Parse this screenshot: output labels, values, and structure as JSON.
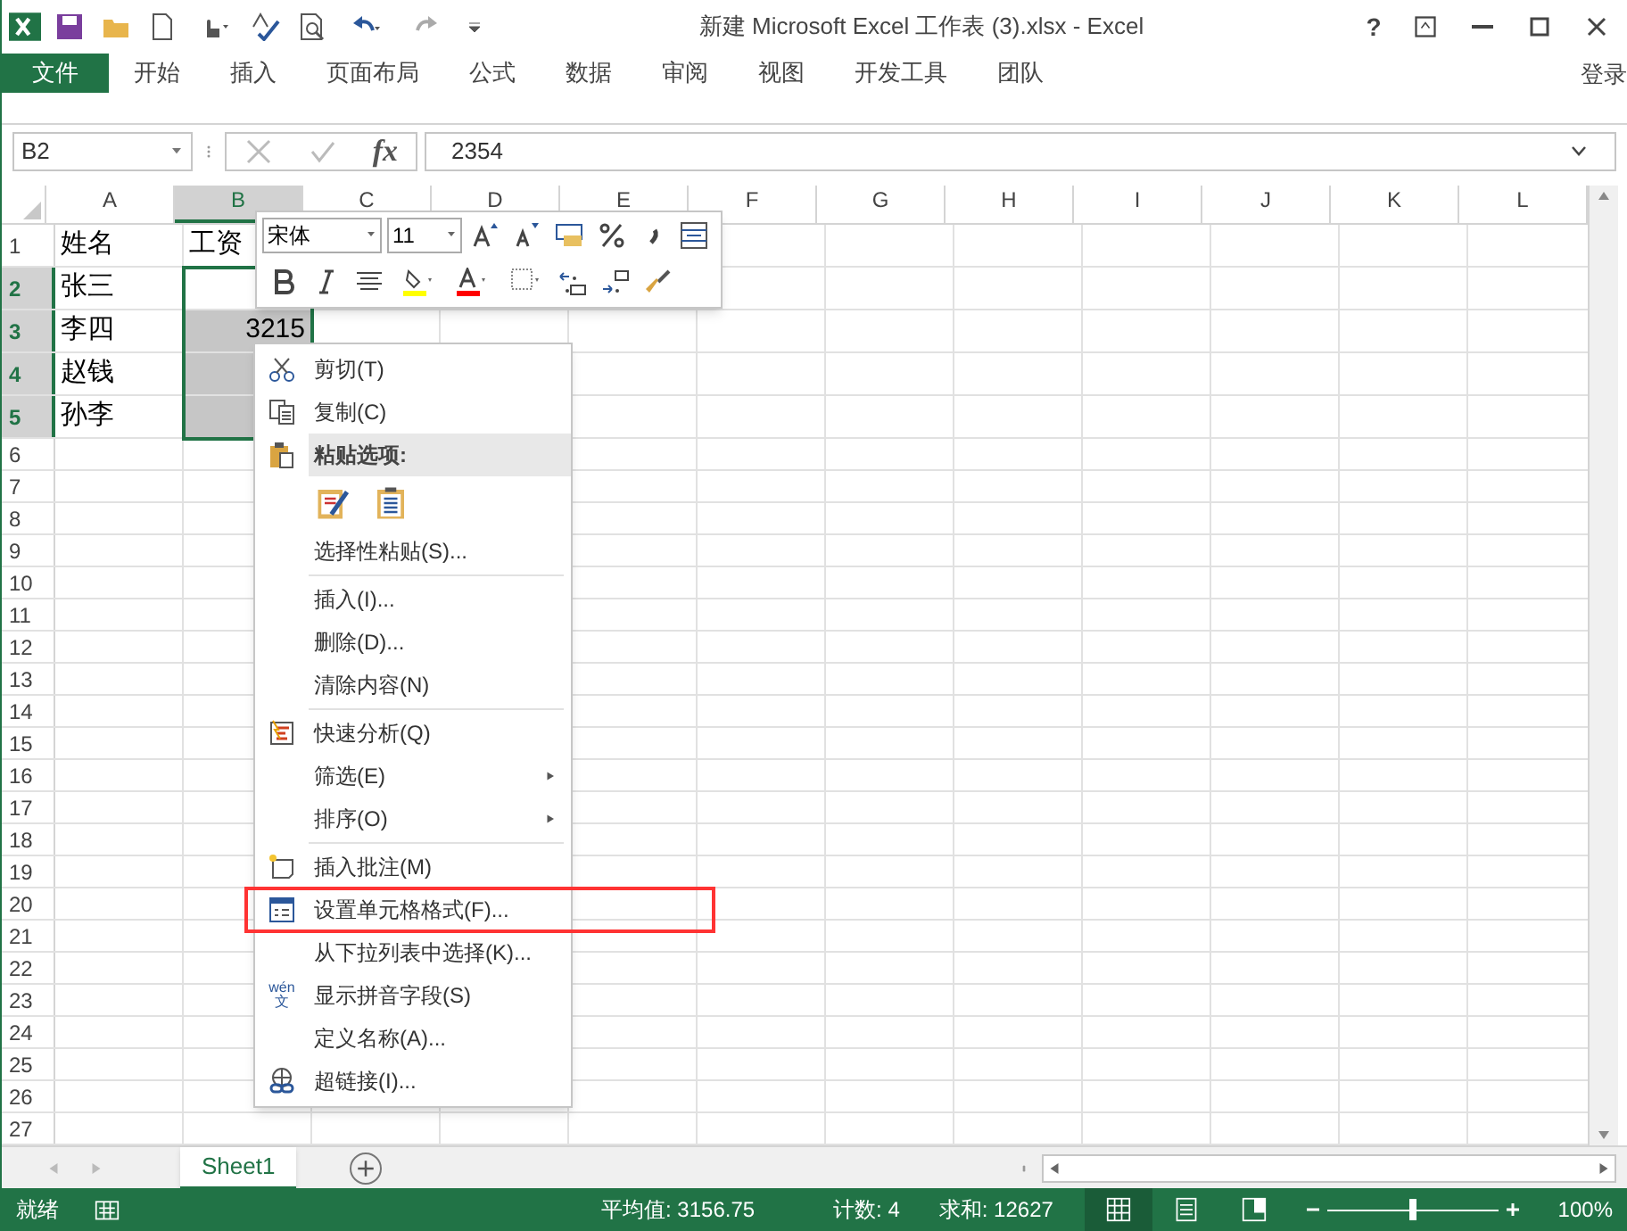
{
  "window": {
    "title": "新建 Microsoft Excel 工作表 (3).xlsx - Excel",
    "help": "?"
  },
  "ribbon_tabs": [
    {
      "label": "文件",
      "kind": "file"
    },
    {
      "label": "开始",
      "kind": "tab"
    },
    {
      "label": "插入",
      "kind": "tab"
    },
    {
      "label": "页面布局",
      "kind": "tab"
    },
    {
      "label": "公式",
      "kind": "tab"
    },
    {
      "label": "数据",
      "kind": "tab"
    },
    {
      "label": "审阅",
      "kind": "tab"
    },
    {
      "label": "视图",
      "kind": "tab"
    },
    {
      "label": "开发工具",
      "kind": "tab"
    },
    {
      "label": "团队",
      "kind": "tab"
    }
  ],
  "sign_in": "登录",
  "formula_bar": {
    "name_box": "B2",
    "fx": "fx",
    "value": "2354"
  },
  "columns": [
    {
      "label": "A",
      "selected": false
    },
    {
      "label": "B",
      "selected": true
    },
    {
      "label": "C",
      "selected": false
    },
    {
      "label": "D",
      "selected": false
    },
    {
      "label": "E",
      "selected": false
    },
    {
      "label": "F",
      "selected": false
    },
    {
      "label": "G",
      "selected": false
    },
    {
      "label": "H",
      "selected": false
    },
    {
      "label": "I",
      "selected": false
    },
    {
      "label": "J",
      "selected": false
    },
    {
      "label": "K",
      "selected": false
    },
    {
      "label": "L",
      "selected": false
    }
  ],
  "rows": [
    {
      "label": "1",
      "selected": false,
      "cells": [
        "姓名",
        "工资"
      ]
    },
    {
      "label": "2",
      "selected": true,
      "cells": [
        "张三",
        ""
      ]
    },
    {
      "label": "3",
      "selected": true,
      "cells": [
        "李四",
        "3215"
      ]
    },
    {
      "label": "4",
      "selected": true,
      "cells": [
        "赵钱",
        ""
      ]
    },
    {
      "label": "5",
      "selected": true,
      "cells": [
        "孙李",
        ""
      ]
    },
    {
      "label": "6",
      "selected": false
    },
    {
      "label": "7",
      "selected": false
    },
    {
      "label": "8",
      "selected": false
    },
    {
      "label": "9",
      "selected": false
    },
    {
      "label": "10",
      "selected": false
    },
    {
      "label": "11",
      "selected": false
    },
    {
      "label": "12",
      "selected": false
    },
    {
      "label": "13",
      "selected": false
    },
    {
      "label": "14",
      "selected": false
    },
    {
      "label": "15",
      "selected": false
    },
    {
      "label": "16",
      "selected": false
    },
    {
      "label": "17",
      "selected": false
    },
    {
      "label": "18",
      "selected": false
    },
    {
      "label": "19",
      "selected": false
    },
    {
      "label": "20",
      "selected": false
    },
    {
      "label": "21",
      "selected": false
    },
    {
      "label": "22",
      "selected": false
    },
    {
      "label": "23",
      "selected": false
    },
    {
      "label": "24",
      "selected": false
    },
    {
      "label": "25",
      "selected": false
    },
    {
      "label": "26",
      "selected": false
    },
    {
      "label": "27",
      "selected": false
    }
  ],
  "mini_toolbar": {
    "font": "宋体",
    "size": "11"
  },
  "context_menu": [
    {
      "kind": "item",
      "label": "剪切(T)"
    },
    {
      "kind": "item",
      "label": "复制(C)"
    },
    {
      "kind": "header",
      "label": "粘贴选项:"
    },
    {
      "kind": "paste_icons"
    },
    {
      "kind": "item",
      "label": "选择性粘贴(S)..."
    },
    {
      "kind": "separator"
    },
    {
      "kind": "item",
      "label": "插入(I)..."
    },
    {
      "kind": "item",
      "label": "删除(D)..."
    },
    {
      "kind": "item",
      "label": "清除内容(N)"
    },
    {
      "kind": "separator"
    },
    {
      "kind": "item",
      "label": "快速分析(Q)"
    },
    {
      "kind": "item",
      "label": "筛选(E)",
      "submenu": true
    },
    {
      "kind": "item",
      "label": "排序(O)",
      "submenu": true
    },
    {
      "kind": "separator"
    },
    {
      "kind": "item",
      "label": "插入批注(M)"
    },
    {
      "kind": "item",
      "label": "设置单元格格式(F)...",
      "highlighted": true
    },
    {
      "kind": "item",
      "label": "从下拉列表中选择(K)..."
    },
    {
      "kind": "item",
      "label": "显示拼音字段(S)",
      "glyph_top": "wén",
      "glyph_bottom": "文"
    },
    {
      "kind": "item",
      "label": "定义名称(A)..."
    },
    {
      "kind": "item",
      "label": "超链接(I)..."
    }
  ],
  "sheet_tabs": [
    {
      "label": "Sheet1",
      "selected": true
    }
  ],
  "status_bar": {
    "ready": "就绪",
    "average": "平均值: 3156.75",
    "count": "计数: 4",
    "sum": "求和: 12627",
    "zoom": "100%",
    "zoom_slider": {
      "level": 0.5
    },
    "views": [
      {
        "selected": true
      },
      {
        "selected": false
      },
      {
        "selected": false
      }
    ]
  }
}
